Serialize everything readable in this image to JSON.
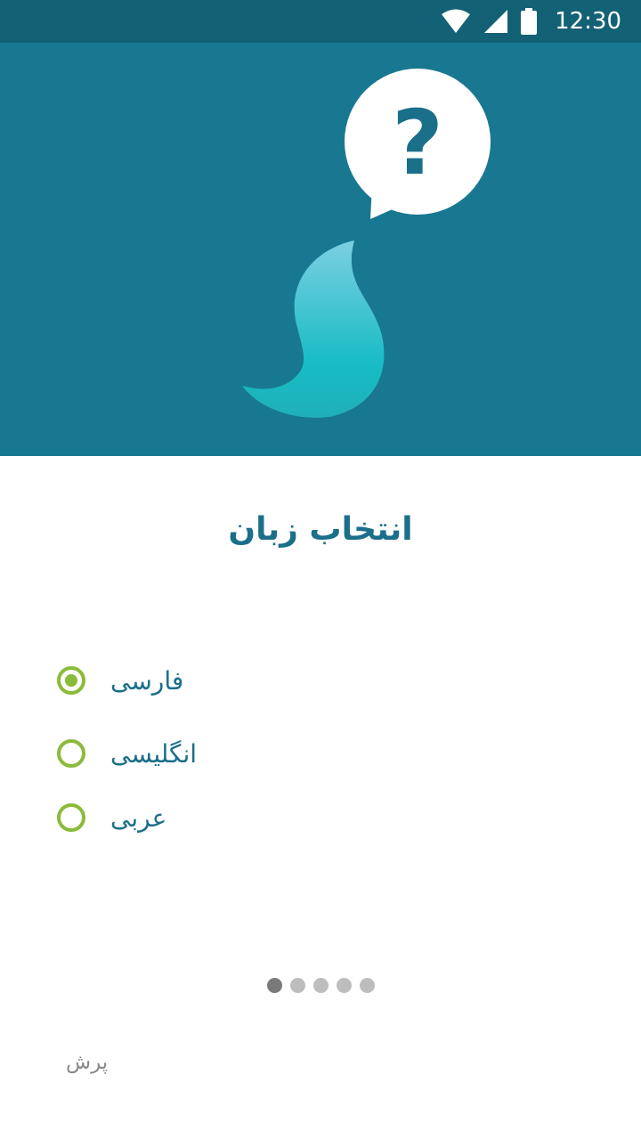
{
  "status_bar": {
    "time": "12:30",
    "icons": [
      "wifi-icon",
      "cell-signal-icon",
      "battery-icon"
    ]
  },
  "hero": {
    "illustration": "question-speech-bubble-and-drop-logo",
    "colors": {
      "background": "#197891",
      "bubble": "#ffffff",
      "question_mark": "#1a6f89",
      "drop_top": "#6fc9dc",
      "drop_bottom": "#16b6c0"
    }
  },
  "language_screen": {
    "title": "انتخاب زبان",
    "options": [
      {
        "label": "فارسی",
        "selected": true
      },
      {
        "label": "انگلیسی",
        "selected": false
      },
      {
        "label": "عربی",
        "selected": false
      }
    ]
  },
  "pager": {
    "count": 5,
    "active_index": 0
  },
  "skip_label": "پرش",
  "colors": {
    "accent_green": "#8bbb3a",
    "text_blue": "#1a6f89",
    "status_bar": "#136175"
  }
}
